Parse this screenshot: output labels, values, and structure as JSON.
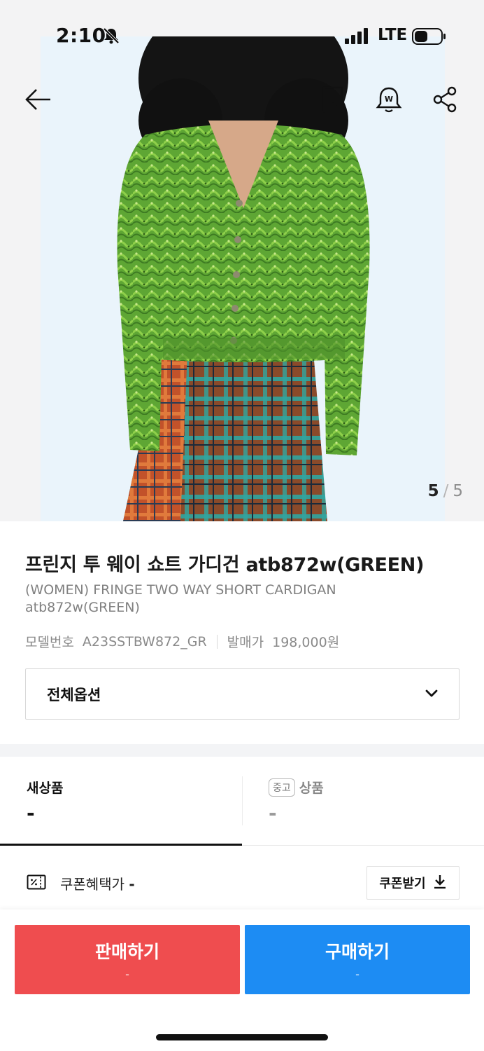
{
  "status_bar": {
    "time": "2:10",
    "network": "LTE",
    "icons": [
      "bell-mute-icon",
      "signal-icon",
      "battery-icon"
    ]
  },
  "nav": {
    "icons": [
      "back-arrow-icon",
      "bookmark-icon",
      "price-alert-bell-icon",
      "share-icon"
    ]
  },
  "gallery": {
    "current": "5",
    "separator": "/",
    "total": "5"
  },
  "product": {
    "title_ko": "프린지 투 웨이 쇼트 가디건 atb872w(GREEN)",
    "title_en": "(WOMEN) FRINGE TWO WAY SHORT CARDIGAN atb872w(GREEN)",
    "model_label": "모델번호",
    "model_value": "A23SSTBW872_GR",
    "release_price_label": "발매가",
    "release_price_value": "198,000원",
    "option_label": "전체옵션"
  },
  "tabs": {
    "new": {
      "label": "새상품",
      "price": "-"
    },
    "used": {
      "badge": "중고",
      "label": "상품",
      "price": "-"
    }
  },
  "coupon": {
    "label": "쿠폰혜택가",
    "value": "-",
    "button": "쿠폰받기"
  },
  "actions": {
    "sell": {
      "label": "판매하기",
      "sub": "-"
    },
    "buy": {
      "label": "구매하기",
      "sub": "-"
    }
  },
  "colors": {
    "sell": "#ef4d4f",
    "buy": "#1d8cf3",
    "sweater": "#5ea634"
  }
}
